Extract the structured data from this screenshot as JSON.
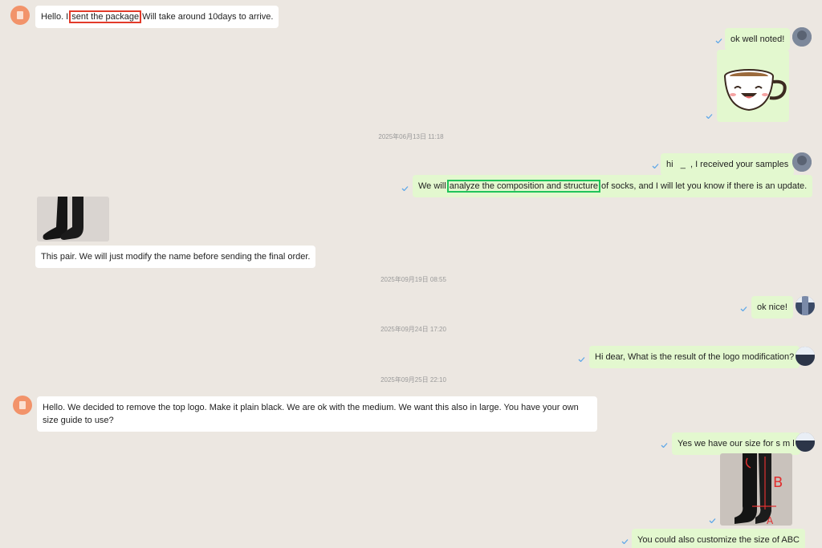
{
  "messages": {
    "m1_before": "Hello. I ",
    "m1_highlight": "sent the package",
    "m1_after": " Will take around 10days to arrive.",
    "m2": "ok well noted!",
    "m3": "hi   _  , I received your samples",
    "m4_before": "We will ",
    "m4_highlight": "analyze the composition and structure",
    "m4_after": " of socks, and I will let you know if there is an update.",
    "m5": "This pair. We will just modify the name before sending the final order.",
    "m6": "ok nice!",
    "m7": "Hi dear, What is the result of the logo modification?",
    "m8": "Hello. We decided to remove the top logo. Make it plain black. We are ok with the medium. We want this also in large. You have your own size guide to use?",
    "m9": "Yes we have our size for s m l",
    "m10": "You could also customize the size of ABC"
  },
  "timestamps": {
    "t1": "2025年06月13日 11:18",
    "t2": "2025年09月19日 08:55",
    "t3": "2025年09月24日 17:20",
    "t4": "2025年09月25日 22:10"
  },
  "photo_annotation": {
    "letter_top": "B",
    "letter_bottom": "A"
  },
  "colors": {
    "background": "#ece7e1",
    "incoming_bubble": "#ffffff",
    "outgoing_bubble": "#e3f8cf",
    "highlight_red": "#e23b2a",
    "highlight_green": "#21c35a",
    "tick_blue": "#5fa8e8"
  }
}
